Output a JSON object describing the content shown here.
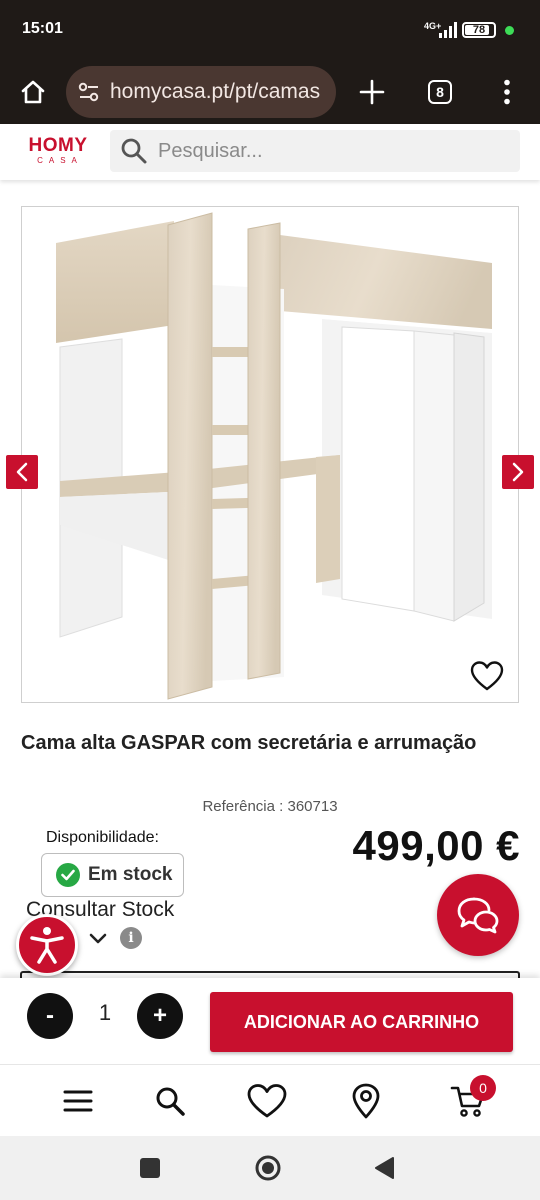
{
  "status_bar": {
    "time": "15:01",
    "network": "4G+",
    "battery": "78"
  },
  "browser": {
    "url": "homycasa.pt/pt/camas",
    "tab_count": "8"
  },
  "site": {
    "logo_top": "HOMY",
    "logo_bottom": "CASA",
    "search_placeholder": "Pesquisar...",
    "brand_color": "#c8102e"
  },
  "product": {
    "title": "Cama alta GASPAR com secretária e arrumação",
    "reference": "Referência : 360713",
    "availability_label": "Disponibilidade:",
    "stock_status": "Em stock",
    "price": "499,00 €",
    "consult_stock": "Consultar Stock",
    "info_icon": "i"
  },
  "cart_bar": {
    "minus": "-",
    "quantity": "1",
    "plus": "+",
    "add_to_cart": "ADICIONAR AO CARRINHO"
  },
  "bottom_nav": {
    "cart_count": "0"
  }
}
